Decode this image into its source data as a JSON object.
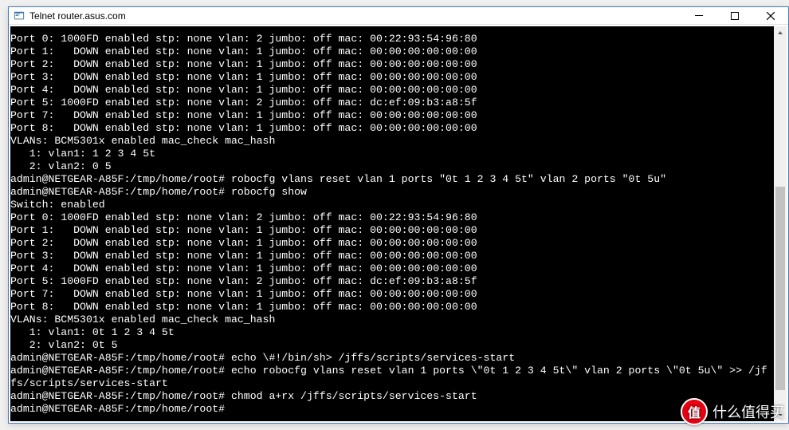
{
  "window": {
    "title": "Telnet router.asus.com"
  },
  "terminal": {
    "lines": [
      "Port 0: 1000FD enabled stp: none vlan: 2 jumbo: off mac: 00:22:93:54:96:80",
      "Port 1:   DOWN enabled stp: none vlan: 1 jumbo: off mac: 00:00:00:00:00:00",
      "Port 2:   DOWN enabled stp: none vlan: 1 jumbo: off mac: 00:00:00:00:00:00",
      "Port 3:   DOWN enabled stp: none vlan: 1 jumbo: off mac: 00:00:00:00:00:00",
      "Port 4:   DOWN enabled stp: none vlan: 1 jumbo: off mac: 00:00:00:00:00:00",
      "Port 5: 1000FD enabled stp: none vlan: 2 jumbo: off mac: dc:ef:09:b3:a8:5f",
      "Port 7:   DOWN enabled stp: none vlan: 1 jumbo: off mac: 00:00:00:00:00:00",
      "Port 8:   DOWN enabled stp: none vlan: 1 jumbo: off mac: 00:00:00:00:00:00",
      "VLANs: BCM5301x enabled mac_check mac_hash",
      "   1: vlan1: 1 2 3 4 5t",
      "   2: vlan2: 0 5",
      "admin@NETGEAR-A85F:/tmp/home/root# robocfg vlans reset vlan 1 ports \"0t 1 2 3 4 5t\" vlan 2 ports \"0t 5u\"",
      "admin@NETGEAR-A85F:/tmp/home/root# robocfg show",
      "Switch: enabled",
      "Port 0: 1000FD enabled stp: none vlan: 2 jumbo: off mac: 00:22:93:54:96:80",
      "Port 1:   DOWN enabled stp: none vlan: 1 jumbo: off mac: 00:00:00:00:00:00",
      "Port 2:   DOWN enabled stp: none vlan: 1 jumbo: off mac: 00:00:00:00:00:00",
      "Port 3:   DOWN enabled stp: none vlan: 1 jumbo: off mac: 00:00:00:00:00:00",
      "Port 4:   DOWN enabled stp: none vlan: 1 jumbo: off mac: 00:00:00:00:00:00",
      "Port 5: 1000FD enabled stp: none vlan: 2 jumbo: off mac: dc:ef:09:b3:a8:5f",
      "Port 7:   DOWN enabled stp: none vlan: 1 jumbo: off mac: 00:00:00:00:00:00",
      "Port 8:   DOWN enabled stp: none vlan: 1 jumbo: off mac: 00:00:00:00:00:00",
      "VLANs: BCM5301x enabled mac_check mac_hash",
      "   1: vlan1: 0t 1 2 3 4 5t",
      "   2: vlan2: 0t 5",
      "admin@NETGEAR-A85F:/tmp/home/root# echo \\#!/bin/sh> /jffs/scripts/services-start",
      "admin@NETGEAR-A85F:/tmp/home/root# echo robocfg vlans reset vlan 1 ports \\\"0t 1 2 3 4 5t\\\" vlan 2 ports \\\"0t 5u\\\" >> /jf",
      "fs/scripts/services-start",
      "admin@NETGEAR-A85F:/tmp/home/root# chmod a+rx /jffs/scripts/services-start",
      "admin@NETGEAR-A85F:/tmp/home/root#"
    ]
  },
  "watermark": {
    "badge": "值",
    "text": "什么值得买"
  }
}
